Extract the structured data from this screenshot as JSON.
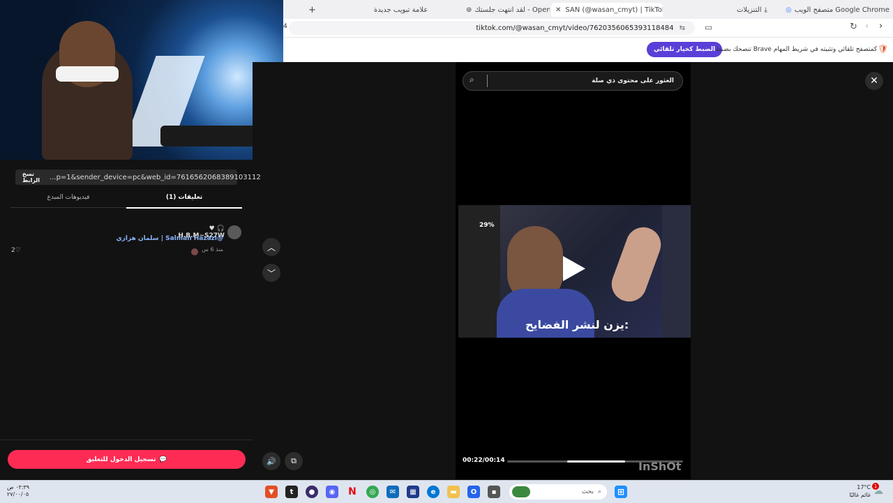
{
  "tabs": [
    {
      "label": "متصفح الويب Google Chrome: إكمال"
    },
    {
      "label": "التنزيلات"
    },
    {
      "label": "SAN (@wasan_cmyt) | TikTok"
    },
    {
      "label": "لقد انتهت جلستك - OpenAI"
    },
    {
      "label": "علامة تبويب جديدة"
    }
  ],
  "address": {
    "url": "tiktok.com/@wasan_cmyt/video/7620356065393118484",
    "left_digit": "4"
  },
  "infobar": {
    "text": "تنصحك بضبط Brave كمتصفح تلقائي وتثبيته في شريط المهام",
    "button": "الضبط كخيار تلقائي"
  },
  "share": {
    "link": "...p=1&sender_device=pc&web_id=7616562068389103112",
    "copy_label": "نسخ الرابط"
  },
  "panel_tabs": {
    "comments": "تعليقات (1)",
    "creator_videos": "فيديوهات المبدع"
  },
  "comment": {
    "username": "H.B.M~S27W",
    "text": "سلمان هزازي | Salman Hazazi@",
    "time": "منذ 6 س",
    "likes": "2"
  },
  "login_button": "تسجيل الدخول للتعليق",
  "player": {
    "search_placeholder": "العثور على محتوى ذي صلة",
    "time": "00:22/00:14",
    "progress": 0.33,
    "caption": "يزن لنشر الفضايح:",
    "watermark": "InShOt",
    "overlay_percent": "29%"
  },
  "taskbar": {
    "search_placeholder": "بحث",
    "weather_temp": "17°C",
    "weather_desc": "غائم غالبًا",
    "notif_count": "1",
    "clock_time": "٠٣:٣٩ ص",
    "clock_date": "٢٧/٠٠/٠٥"
  },
  "colors": {
    "accent": "#fe2c55",
    "brave_purple": "#5a3fd8",
    "link_blue": "#8ab4f8"
  }
}
